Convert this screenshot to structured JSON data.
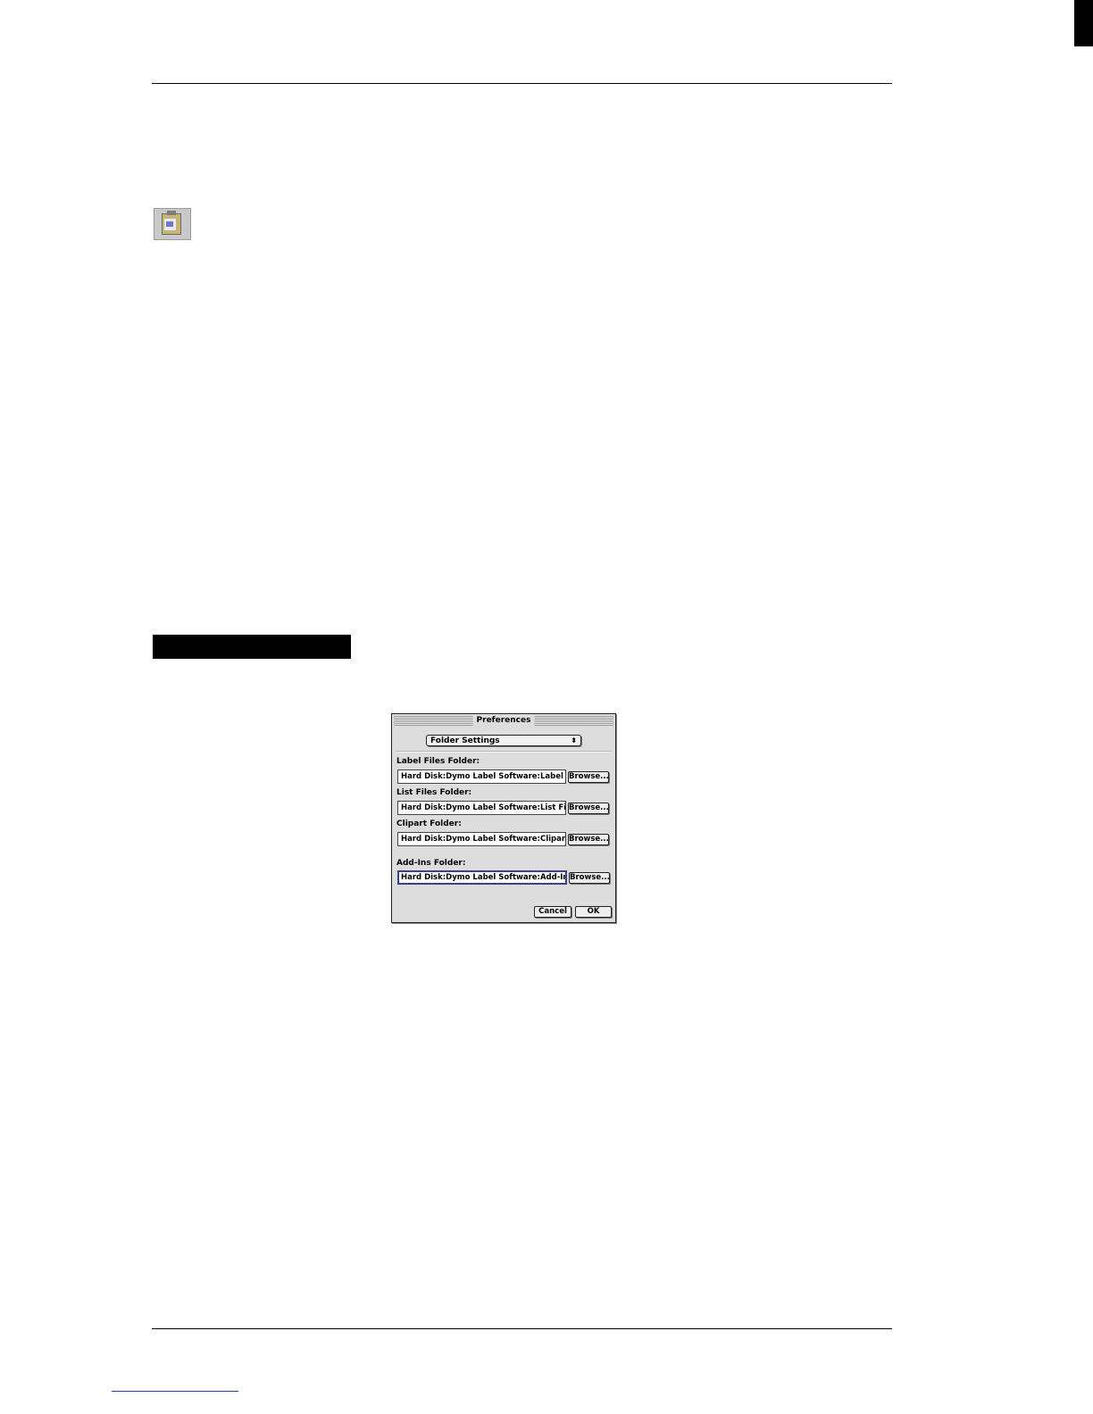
{
  "dialog": {
    "title": "Preferences",
    "popup_value": "Folder Settings",
    "popup_arrows": "⬍",
    "fields": [
      {
        "label": "Label Files Folder:",
        "value": "Hard Disk:Dymo Label Software:Label File",
        "button": "Browse..."
      },
      {
        "label": "List Files Folder:",
        "value": "Hard Disk:Dymo Label Software:List Files",
        "button": "Browse..."
      },
      {
        "label": "Clipart Folder:",
        "value": "Hard Disk:Dymo Label Software:Clipart",
        "button": "Browse..."
      },
      {
        "label": "Add-Ins Folder:",
        "value": "Hard Disk:Dymo Label Software:Add-Ins",
        "button": "Browse..."
      }
    ],
    "cancel_label": "Cancel",
    "ok_label": "OK"
  },
  "icons": {
    "paste": "paste-icon"
  }
}
